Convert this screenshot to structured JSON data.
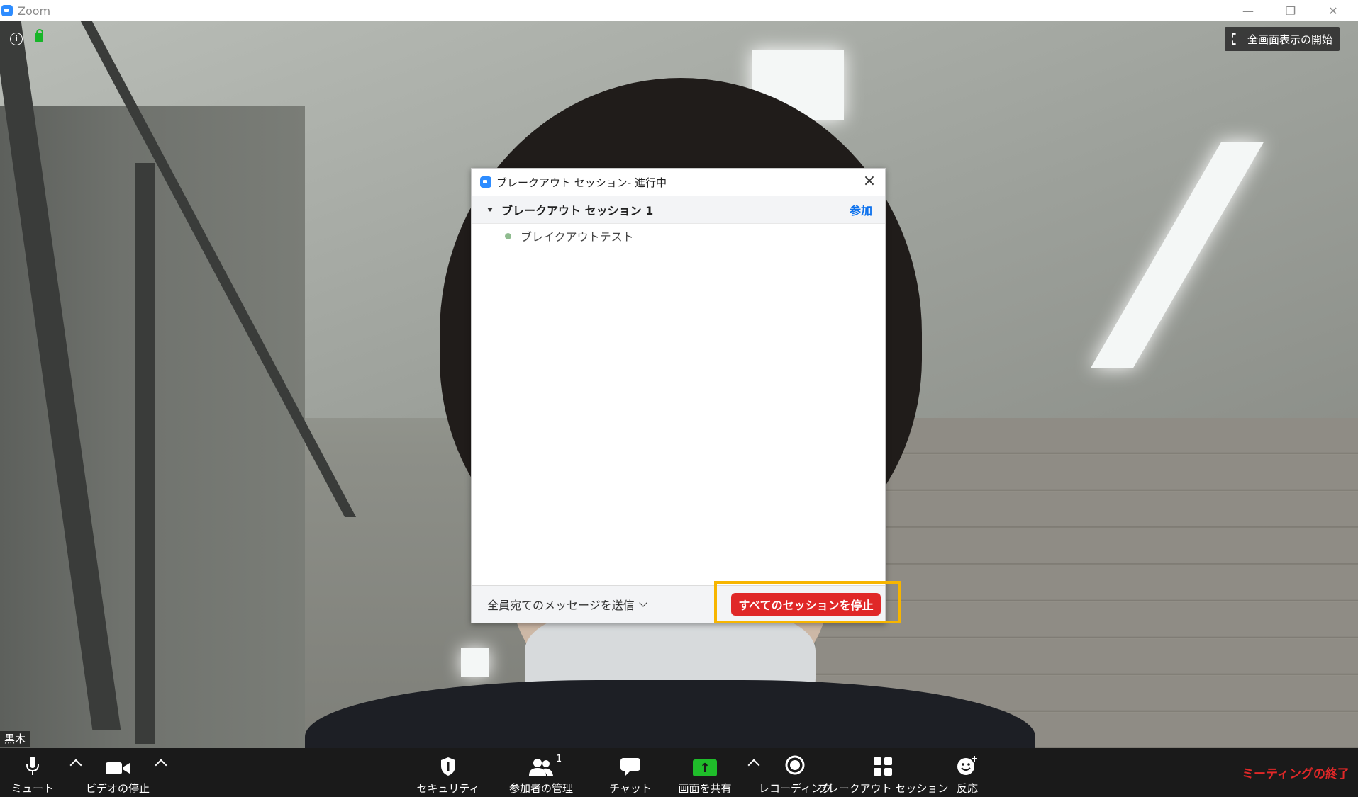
{
  "window": {
    "title": "Zoom"
  },
  "video": {
    "fullscreen_label": "全画面表示の開始",
    "participant_name": "黒木"
  },
  "dialog": {
    "title": "ブレークアウト セッション- 進行中",
    "session": {
      "name": "ブレークアウト セッション 1",
      "join_label": "参加"
    },
    "participants": [
      "ブレイクアウトテスト"
    ],
    "broadcast_label": "全員宛てのメッセージを送信",
    "stop_all_label": "すべてのセッションを停止"
  },
  "toolbar": {
    "mute": "ミュート",
    "video": "ビデオの停止",
    "security": "セキュリティ",
    "participants": "参加者の管理",
    "participants_count": "1",
    "chat": "チャット",
    "share": "画面を共有",
    "record": "レコーディング",
    "breakout": "ブレークアウト セッション",
    "reactions": "反応",
    "end": "ミーティングの終了"
  },
  "colors": {
    "accent": "#2d8cff",
    "stop": "#e02828",
    "highlight": "#f7b500",
    "share_green": "#1fbd2a"
  }
}
